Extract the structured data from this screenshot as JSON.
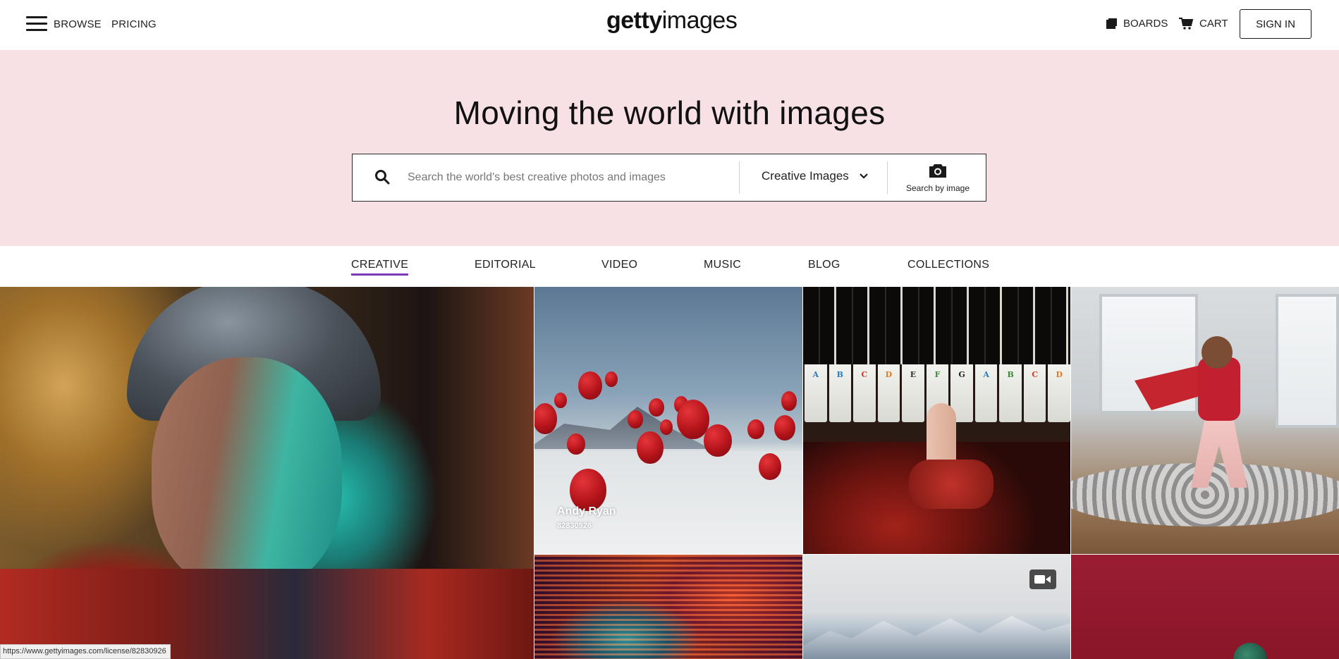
{
  "header": {
    "browse_label": "BROWSE",
    "pricing_label": "PRICING",
    "logo_bold": "getty",
    "logo_light": "images",
    "boards_label": "BOARDS",
    "cart_label": "CART",
    "signin_label": "SIGN IN"
  },
  "hero": {
    "title": "Moving the world with images",
    "search_placeholder": "Search the world's best creative photos and images",
    "search_value": "",
    "type_selected": "Creative Images",
    "search_by_image_label": "Search by image"
  },
  "tabs": [
    {
      "label": "CREATIVE",
      "active": true
    },
    {
      "label": "EDITORIAL"
    },
    {
      "label": "VIDEO"
    },
    {
      "label": "MUSIC"
    },
    {
      "label": "BLOG"
    },
    {
      "label": "COLLECTIONS"
    }
  ],
  "grid": {
    "hover_caption": {
      "artist": "Andy Ryan",
      "image_id": "82830926"
    },
    "piano_key_letters": [
      "A",
      "B",
      "C",
      "D",
      "E",
      "F",
      "G",
      "A",
      "B",
      "C",
      "D"
    ]
  },
  "statusbar": {
    "url": "https://www.gettyimages.com/license/82830926"
  },
  "colors": {
    "hero_bg": "#f7e1e4",
    "active_tab_underline": "#7d3ab8",
    "text": "#1a1a1a"
  },
  "icons": [
    "hamburger-icon",
    "boards-icon",
    "cart-icon",
    "search-icon",
    "chevron-down-icon",
    "camera-icon",
    "video-camera-icon"
  ]
}
